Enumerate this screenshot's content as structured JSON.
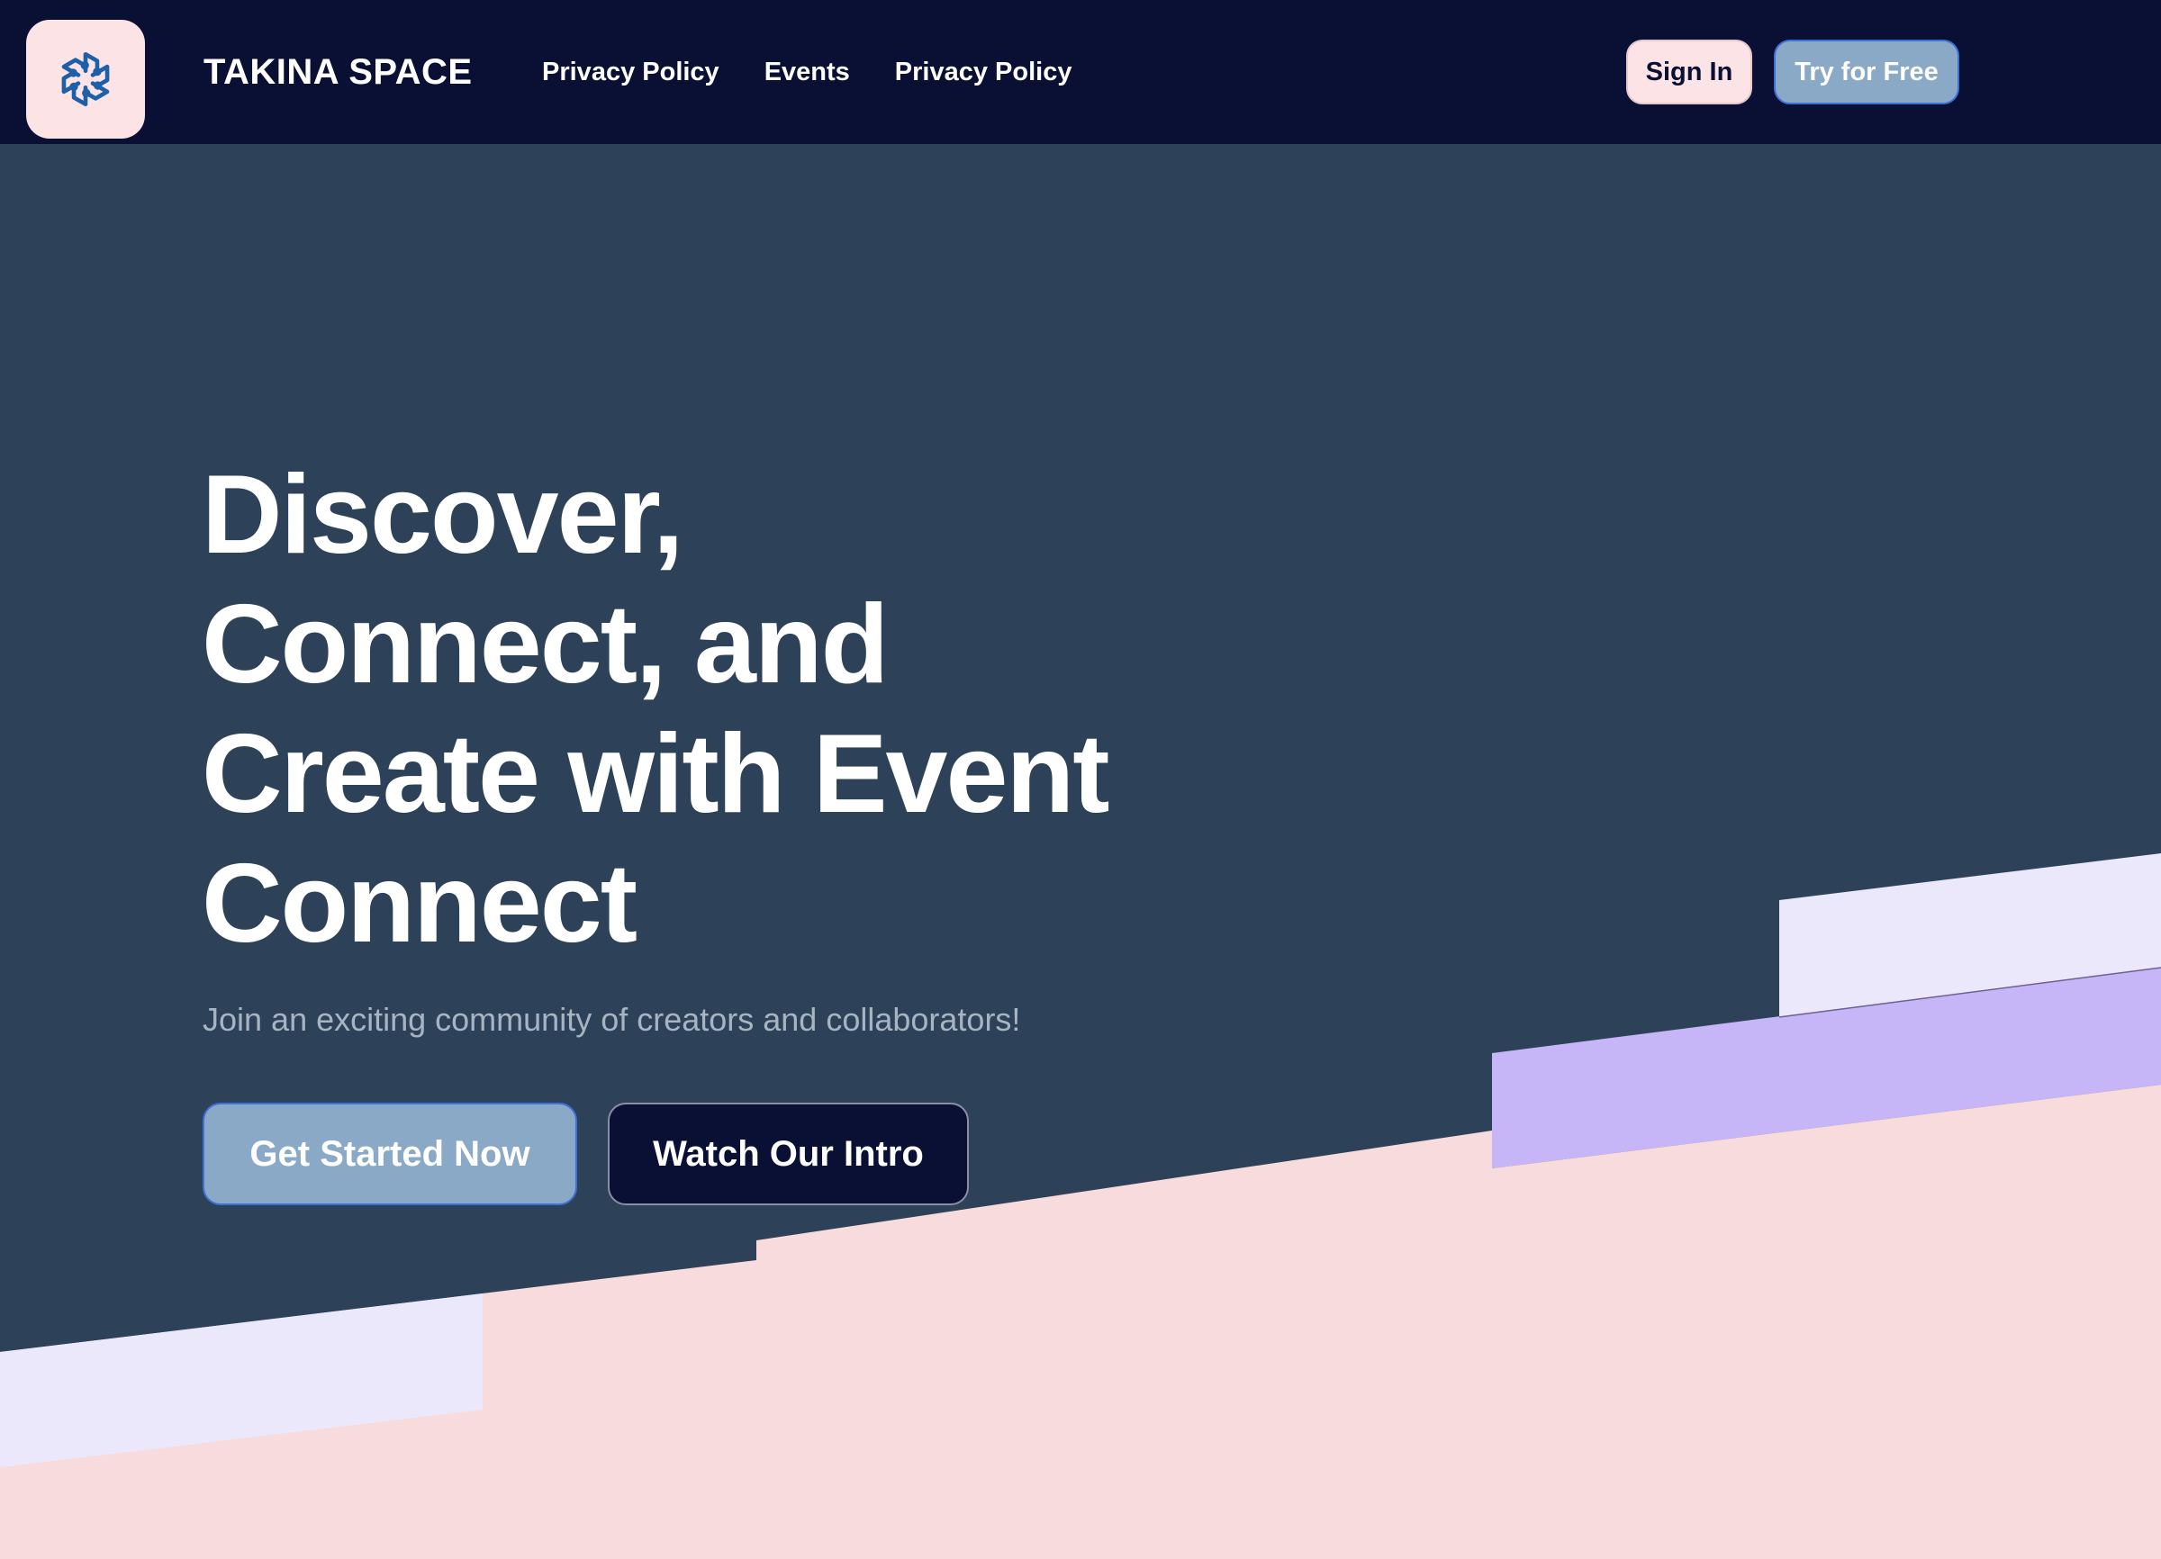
{
  "header": {
    "brand": "TAKINA SPACE",
    "logo_icon": "hexagonal-swirl-logo-icon",
    "nav": [
      {
        "label": "Privacy Policy"
      },
      {
        "label": "Events"
      },
      {
        "label": "Privacy Policy"
      }
    ],
    "sign_in_label": "Sign In",
    "try_free_label": "Try for Free"
  },
  "hero": {
    "title_lines": [
      "Discover,",
      "Connect, and",
      "Create with Event",
      "Connect"
    ],
    "subtitle": "Join an exciting community of creators and collaborators!",
    "primary_cta": "Get Started Now",
    "secondary_cta": "Watch Our Intro"
  },
  "colors": {
    "header_bg": "#0a1034",
    "hero_bg": "#2d4259",
    "pink": "#f8dcdd",
    "lavender": "#ece8fc",
    "purple": "#c6b6f7",
    "button_blue": "#8aa9c6",
    "accent_border": "#3f6fd8"
  }
}
